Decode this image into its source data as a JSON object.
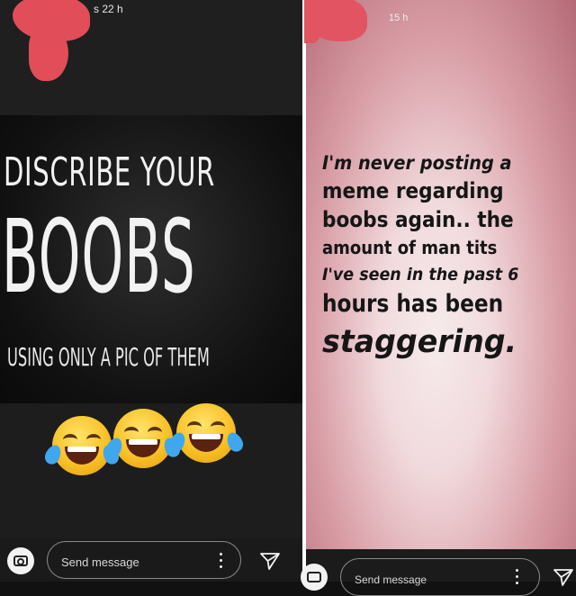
{
  "left_story": {
    "time_ago": "s 22 h",
    "meme": {
      "line1": "DISCRIBE YOUR",
      "line2": "BOOBS",
      "line3": "USING ONLY A PIC OF THEM"
    },
    "reaction_icons": [
      "laughing-crying-emoji",
      "laughing-crying-emoji",
      "laughing-crying-emoji"
    ],
    "reply_bar": {
      "placeholder": "Send message",
      "icons": [
        "camera-icon",
        "more-options-icon",
        "send-icon"
      ]
    }
  },
  "right_story": {
    "time_ago": "15 h",
    "text_lines": [
      "I'm never posting a",
      "meme regarding",
      "boobs again.. the",
      "amount of man tits",
      "I've seen in the past 6",
      "hours has been",
      "staggering."
    ],
    "reply_bar": {
      "placeholder": "Send message",
      "icons": [
        "camera-icon",
        "more-options-icon",
        "send-icon"
      ]
    }
  },
  "colors": {
    "redaction": "#e24d5a",
    "left_background": "#1d1d1d",
    "right_background_center": "#f6ebec",
    "right_background_edge": "#b46a76"
  }
}
